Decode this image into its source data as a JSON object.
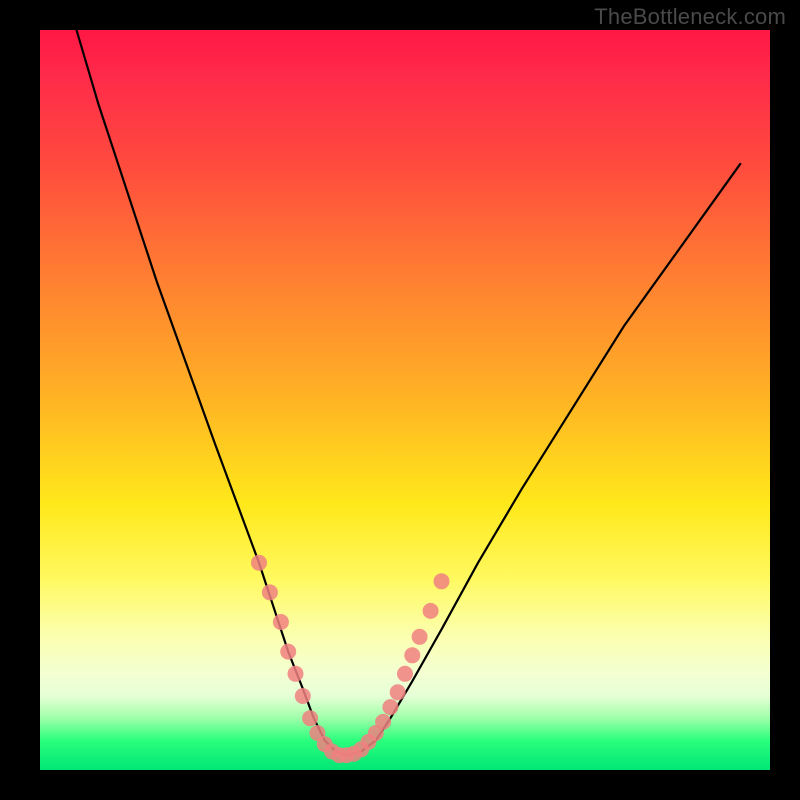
{
  "watermark": "TheBottleneck.com",
  "chart_data": {
    "type": "line",
    "title": "",
    "xlabel": "",
    "ylabel": "",
    "xlim": [
      0,
      100
    ],
    "ylim": [
      0,
      100
    ],
    "grid": false,
    "series": [
      {
        "name": "curve",
        "x": [
          5,
          8,
          12,
          16,
          20,
          24,
          27,
          30,
          32,
          34,
          36,
          37.5,
          39,
          40.5,
          42,
          44,
          46,
          48,
          51,
          55,
          60,
          66,
          73,
          80,
          88,
          96
        ],
        "y": [
          100,
          90,
          78,
          66,
          55,
          44,
          36,
          28,
          22,
          16,
          11,
          7,
          4,
          2.5,
          2,
          2.5,
          4,
          7,
          12,
          19,
          28,
          38,
          49,
          60,
          71,
          82
        ]
      }
    ],
    "markers": {
      "name": "highlight-points",
      "style": "salmon-dots",
      "x": [
        30,
        31.5,
        33,
        34,
        35,
        36,
        37,
        38,
        39,
        40,
        41,
        42,
        43,
        44,
        45,
        46,
        47,
        48,
        49,
        50,
        51,
        52,
        53.5,
        55
      ],
      "y": [
        28,
        24,
        20,
        16,
        13,
        10,
        7,
        5,
        3.5,
        2.5,
        2,
        2,
        2.2,
        2.8,
        3.8,
        5,
        6.5,
        8.5,
        10.5,
        13,
        15.5,
        18,
        21.5,
        25.5
      ]
    },
    "colors": {
      "curve": "#000000",
      "markers": "#f08080",
      "gradient_top": "#ff1744",
      "gradient_mid": "#ffe81a",
      "gradient_bottom": "#00e676",
      "frame": "#000000"
    }
  }
}
